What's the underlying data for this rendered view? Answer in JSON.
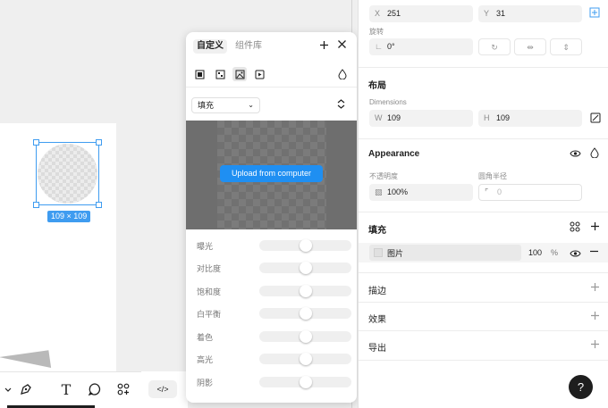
{
  "canvas": {
    "selection_size": "109 × 109"
  },
  "toolbar": {
    "icons": [
      "chevron-down-icon",
      "pen-icon",
      "text-icon",
      "comment-icon",
      "plugins-icon",
      "code-icon"
    ],
    "text_tool_glyph": "T",
    "code_glyph": "</>"
  },
  "fill_popover": {
    "tab_custom": "自定义",
    "tab_library": "组件库",
    "fill_type": "填充",
    "upload_label": "Upload from computer",
    "adjustments": [
      {
        "label": "曝光",
        "value": 0.5
      },
      {
        "label": "对比度",
        "value": 0.5
      },
      {
        "label": "饱和度",
        "value": 0.5
      },
      {
        "label": "白平衡",
        "value": 0.5
      },
      {
        "label": "着色",
        "value": 0.5
      },
      {
        "label": "高光",
        "value": 0.5
      },
      {
        "label": "阴影",
        "value": 0.5
      }
    ]
  },
  "properties": {
    "x_label": "X",
    "x_value": "251",
    "y_label": "Y",
    "y_value": "31",
    "rotation_label": "旋转",
    "rotation_value": "0°",
    "layout_title": "布局",
    "dimensions_label": "Dimensions",
    "w_label": "W",
    "w_value": "109",
    "h_label": "H",
    "h_value": "109",
    "appearance_title": "Appearance",
    "opacity_label": "不透明度",
    "opacity_value": "100%",
    "radius_label": "圆角半径",
    "radius_value": "0",
    "fill_title": "填充",
    "fill_item_label": "图片",
    "fill_item_opacity": "100",
    "fill_item_pct": "%",
    "stroke_title": "描边",
    "effects_title": "效果",
    "export_title": "导出"
  },
  "help": {
    "label": "?"
  }
}
